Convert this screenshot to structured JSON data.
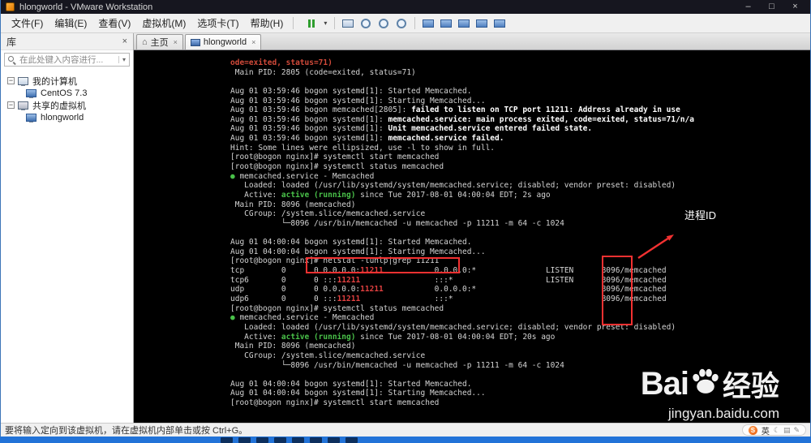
{
  "window": {
    "title": "hlongworld - VMware Workstation",
    "controls": {
      "minimize": "–",
      "maximize": "□",
      "close": "×"
    }
  },
  "menu": {
    "items": [
      "文件(F)",
      "编辑(E)",
      "查看(V)",
      "虚拟机(M)",
      "选项卡(T)",
      "帮助(H)"
    ]
  },
  "toolbar": {
    "icons": [
      {
        "name": "power-pause-button",
        "kind": "pause"
      },
      {
        "name": "power-options-dropdown",
        "kind": "caret",
        "glyph": "▾"
      },
      {
        "name": "toolbar-separator",
        "kind": "sep"
      },
      {
        "name": "send-ctrl-alt-del-button",
        "kind": "kb"
      },
      {
        "name": "take-snapshot-button",
        "kind": "round"
      },
      {
        "name": "revert-snapshot-button",
        "kind": "round"
      },
      {
        "name": "manage-snapshots-button",
        "kind": "round"
      },
      {
        "name": "toolbar-separator",
        "kind": "sep"
      },
      {
        "name": "show-library-button",
        "kind": "screen"
      },
      {
        "name": "console-view-button",
        "kind": "screen"
      },
      {
        "name": "fullscreen-button",
        "kind": "screen"
      },
      {
        "name": "unity-mode-button",
        "kind": "screen"
      },
      {
        "name": "show-thumbnail-bar-button",
        "kind": "screen"
      }
    ]
  },
  "sidebar": {
    "header": "库",
    "close_icon": "×",
    "search": {
      "placeholder": "在此处键入内容进行...",
      "caret": "▾"
    },
    "tree": [
      {
        "label": "我的计算机",
        "type": "computer",
        "level": 0,
        "toggle": true
      },
      {
        "label": "CentOS 7.3",
        "type": "vm",
        "level": 1
      },
      {
        "label": "共享的虚拟机",
        "type": "shared",
        "level": 0,
        "toggle": true
      },
      {
        "label": "hlongworld",
        "type": "vm",
        "level": 1
      }
    ]
  },
  "tabs": [
    {
      "label": "主页",
      "icon": "home",
      "glyph": "⌂",
      "close_icon": "×",
      "active": false
    },
    {
      "label": "hlongworld",
      "icon": "vm",
      "glyph": "",
      "close_icon": "×",
      "active": true
    }
  ],
  "terminal": {
    "lines": [
      [
        [
          "r",
          "ode=exited, status=71)"
        ]
      ],
      [
        [
          "n",
          " Main PID: 2805 (code=exited, status=71)"
        ]
      ],
      [],
      [
        [
          "n",
          "Aug 01 03:59:46 bogon systemd[1]: Started Memcached."
        ]
      ],
      [
        [
          "n",
          "Aug 01 03:59:46 bogon systemd[1]: Starting Memcached..."
        ]
      ],
      [
        [
          "n",
          "Aug 01 03:59:46 bogon memcached[2805]: "
        ],
        [
          "b",
          "failed to listen on TCP port 11211: Address already in use"
        ]
      ],
      [
        [
          "n",
          "Aug 01 03:59:46 bogon systemd[1]: "
        ],
        [
          "b",
          "memcached.service: main process exited, code=exited, status=71/n/a"
        ]
      ],
      [
        [
          "n",
          "Aug 01 03:59:46 bogon systemd[1]: "
        ],
        [
          "b",
          "Unit memcached.service entered failed state."
        ]
      ],
      [
        [
          "n",
          "Aug 01 03:59:46 bogon systemd[1]: "
        ],
        [
          "b",
          "memcached.service failed."
        ]
      ],
      [
        [
          "n",
          "Hint: Some lines were ellipsized, use -l to show in full."
        ]
      ],
      [
        [
          "n",
          "[root@bogon nginx]# systemctl start memcached"
        ]
      ],
      [
        [
          "n",
          "[root@bogon nginx]# systemctl status memcached"
        ]
      ],
      [
        [
          "g",
          "●"
        ],
        [
          "n",
          " memcached.service - Memcached"
        ]
      ],
      [
        [
          "n",
          "   Loaded: loaded (/usr/lib/systemd/system/memcached.service; disabled; vendor preset: disabled)"
        ]
      ],
      [
        [
          "n",
          "   Active: "
        ],
        [
          "g",
          "active (running)"
        ],
        [
          "n",
          " since Tue 2017-08-01 04:00:04 EDT; 2s ago"
        ]
      ],
      [
        [
          "n",
          " Main PID: 8096 (memcached)"
        ]
      ],
      [
        [
          "n",
          "   CGroup: /system.slice/memcached.service"
        ]
      ],
      [
        [
          "n",
          "           └─8096 /usr/bin/memcached -u memcached -p 11211 -m 64 -c 1024"
        ]
      ],
      [],
      [
        [
          "n",
          "Aug 01 04:00:04 bogon systemd[1]: Started Memcached."
        ]
      ],
      [
        [
          "n",
          "Aug 01 04:00:04 bogon systemd[1]: Starting Memcached..."
        ]
      ],
      [
        [
          "n",
          "[root@bogon nginx]# netstat -tunlp|grep 11211"
        ]
      ],
      [
        [
          "n",
          "tcp        0      0 0.0.0.0:"
        ],
        [
          "m",
          "11211"
        ],
        [
          "n",
          "           0.0.0.0:*               LISTEN      8096/memcached"
        ]
      ],
      [
        [
          "n",
          "tcp6       0      0 :::"
        ],
        [
          "m",
          "11211"
        ],
        [
          "n",
          "                :::*                    LISTEN      8096/memcached"
        ]
      ],
      [
        [
          "n",
          "udp        0      0 0.0.0.0:"
        ],
        [
          "m",
          "11211"
        ],
        [
          "n",
          "           0.0.0.0:*                           8096/memcached"
        ]
      ],
      [
        [
          "n",
          "udp6       0      0 :::"
        ],
        [
          "m",
          "11211"
        ],
        [
          "n",
          "                :::*                                8096/memcached"
        ]
      ],
      [
        [
          "n",
          "[root@bogon nginx]# systemctl status memcached"
        ]
      ],
      [
        [
          "g",
          "●"
        ],
        [
          "n",
          " memcached.service - Memcached"
        ]
      ],
      [
        [
          "n",
          "   Loaded: loaded (/usr/lib/systemd/system/memcached.service; disabled; vendor preset: disabled)"
        ]
      ],
      [
        [
          "n",
          "   Active: "
        ],
        [
          "g",
          "active (running)"
        ],
        [
          "n",
          " since Tue 2017-08-01 04:00:04 EDT; 20s ago"
        ]
      ],
      [
        [
          "n",
          " Main PID: 8096 (memcached)"
        ]
      ],
      [
        [
          "n",
          "   CGroup: /system.slice/memcached.service"
        ]
      ],
      [
        [
          "n",
          "           └─8096 /usr/bin/memcached -u memcached -p 11211 -m 64 -c 1024"
        ]
      ],
      [],
      [
        [
          "n",
          "Aug 01 04:00:04 bogon systemd[1]: Started Memcached."
        ]
      ],
      [
        [
          "n",
          "Aug 01 04:00:04 bogon systemd[1]: Starting Memcached..."
        ]
      ],
      [
        [
          "n",
          "[root@bogon nginx]# systemctl start memcached"
        ]
      ]
    ]
  },
  "annotations": {
    "process_id_label": "进程ID"
  },
  "watermark": {
    "prefix": "Bai",
    "suffix": "经验",
    "domain": "jingyan.baidu.com"
  },
  "statusbar": {
    "message": "要将输入定向到该虚拟机，请在虚拟机内部单击或按 Ctrl+G。",
    "ime": {
      "logo": "S",
      "mode": "英",
      "extras": [
        "☾",
        "▤",
        "✎"
      ]
    }
  },
  "taskbar": {
    "pinned_count": 8
  }
}
